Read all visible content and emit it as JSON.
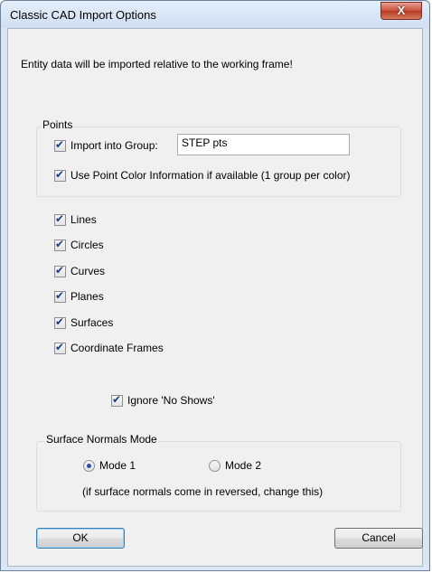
{
  "window": {
    "title": "Classic CAD Import Options",
    "close_label": "X"
  },
  "message": "Entity data will be imported relative to the working frame!",
  "points_group": {
    "legend": "Points",
    "import_into_group": {
      "label": "Import into Group:",
      "checked": true,
      "value": "STEP pts"
    },
    "use_point_color": {
      "label": "Use Point Color Information if available (1 group per color)",
      "checked": true
    }
  },
  "entities": [
    {
      "label": "Lines",
      "checked": true
    },
    {
      "label": "Circles",
      "checked": true
    },
    {
      "label": "Curves",
      "checked": true
    },
    {
      "label": "Planes",
      "checked": true
    },
    {
      "label": "Surfaces",
      "checked": true
    },
    {
      "label": "Coordinate Frames",
      "checked": true
    }
  ],
  "ignore_no_shows": {
    "label": "Ignore 'No Shows'",
    "checked": true
  },
  "surface_normals": {
    "legend": "Surface Normals Mode",
    "mode1": {
      "label": "Mode 1",
      "selected": true
    },
    "mode2": {
      "label": "Mode 2",
      "selected": false
    },
    "hint": "(if surface normals come in reversed, change this)"
  },
  "buttons": {
    "ok": "OK",
    "cancel": "Cancel"
  }
}
